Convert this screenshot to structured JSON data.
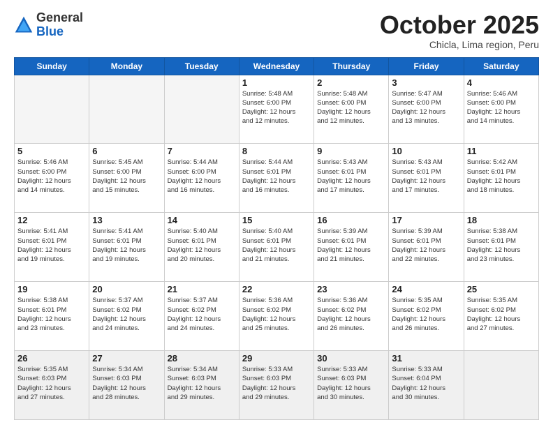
{
  "header": {
    "logo_general": "General",
    "logo_blue": "Blue",
    "month_title": "October 2025",
    "location": "Chicla, Lima region, Peru"
  },
  "weekdays": [
    "Sunday",
    "Monday",
    "Tuesday",
    "Wednesday",
    "Thursday",
    "Friday",
    "Saturday"
  ],
  "weeks": [
    [
      {
        "day": "",
        "detail": ""
      },
      {
        "day": "",
        "detail": ""
      },
      {
        "day": "",
        "detail": ""
      },
      {
        "day": "1",
        "detail": "Sunrise: 5:48 AM\nSunset: 6:00 PM\nDaylight: 12 hours\nand 12 minutes."
      },
      {
        "day": "2",
        "detail": "Sunrise: 5:48 AM\nSunset: 6:00 PM\nDaylight: 12 hours\nand 12 minutes."
      },
      {
        "day": "3",
        "detail": "Sunrise: 5:47 AM\nSunset: 6:00 PM\nDaylight: 12 hours\nand 13 minutes."
      },
      {
        "day": "4",
        "detail": "Sunrise: 5:46 AM\nSunset: 6:00 PM\nDaylight: 12 hours\nand 14 minutes."
      }
    ],
    [
      {
        "day": "5",
        "detail": "Sunrise: 5:46 AM\nSunset: 6:00 PM\nDaylight: 12 hours\nand 14 minutes."
      },
      {
        "day": "6",
        "detail": "Sunrise: 5:45 AM\nSunset: 6:00 PM\nDaylight: 12 hours\nand 15 minutes."
      },
      {
        "day": "7",
        "detail": "Sunrise: 5:44 AM\nSunset: 6:00 PM\nDaylight: 12 hours\nand 16 minutes."
      },
      {
        "day": "8",
        "detail": "Sunrise: 5:44 AM\nSunset: 6:01 PM\nDaylight: 12 hours\nand 16 minutes."
      },
      {
        "day": "9",
        "detail": "Sunrise: 5:43 AM\nSunset: 6:01 PM\nDaylight: 12 hours\nand 17 minutes."
      },
      {
        "day": "10",
        "detail": "Sunrise: 5:43 AM\nSunset: 6:01 PM\nDaylight: 12 hours\nand 17 minutes."
      },
      {
        "day": "11",
        "detail": "Sunrise: 5:42 AM\nSunset: 6:01 PM\nDaylight: 12 hours\nand 18 minutes."
      }
    ],
    [
      {
        "day": "12",
        "detail": "Sunrise: 5:41 AM\nSunset: 6:01 PM\nDaylight: 12 hours\nand 19 minutes."
      },
      {
        "day": "13",
        "detail": "Sunrise: 5:41 AM\nSunset: 6:01 PM\nDaylight: 12 hours\nand 19 minutes."
      },
      {
        "day": "14",
        "detail": "Sunrise: 5:40 AM\nSunset: 6:01 PM\nDaylight: 12 hours\nand 20 minutes."
      },
      {
        "day": "15",
        "detail": "Sunrise: 5:40 AM\nSunset: 6:01 PM\nDaylight: 12 hours\nand 21 minutes."
      },
      {
        "day": "16",
        "detail": "Sunrise: 5:39 AM\nSunset: 6:01 PM\nDaylight: 12 hours\nand 21 minutes."
      },
      {
        "day": "17",
        "detail": "Sunrise: 5:39 AM\nSunset: 6:01 PM\nDaylight: 12 hours\nand 22 minutes."
      },
      {
        "day": "18",
        "detail": "Sunrise: 5:38 AM\nSunset: 6:01 PM\nDaylight: 12 hours\nand 23 minutes."
      }
    ],
    [
      {
        "day": "19",
        "detail": "Sunrise: 5:38 AM\nSunset: 6:01 PM\nDaylight: 12 hours\nand 23 minutes."
      },
      {
        "day": "20",
        "detail": "Sunrise: 5:37 AM\nSunset: 6:02 PM\nDaylight: 12 hours\nand 24 minutes."
      },
      {
        "day": "21",
        "detail": "Sunrise: 5:37 AM\nSunset: 6:02 PM\nDaylight: 12 hours\nand 24 minutes."
      },
      {
        "day": "22",
        "detail": "Sunrise: 5:36 AM\nSunset: 6:02 PM\nDaylight: 12 hours\nand 25 minutes."
      },
      {
        "day": "23",
        "detail": "Sunrise: 5:36 AM\nSunset: 6:02 PM\nDaylight: 12 hours\nand 26 minutes."
      },
      {
        "day": "24",
        "detail": "Sunrise: 5:35 AM\nSunset: 6:02 PM\nDaylight: 12 hours\nand 26 minutes."
      },
      {
        "day": "25",
        "detail": "Sunrise: 5:35 AM\nSunset: 6:02 PM\nDaylight: 12 hours\nand 27 minutes."
      }
    ],
    [
      {
        "day": "26",
        "detail": "Sunrise: 5:35 AM\nSunset: 6:03 PM\nDaylight: 12 hours\nand 27 minutes."
      },
      {
        "day": "27",
        "detail": "Sunrise: 5:34 AM\nSunset: 6:03 PM\nDaylight: 12 hours\nand 28 minutes."
      },
      {
        "day": "28",
        "detail": "Sunrise: 5:34 AM\nSunset: 6:03 PM\nDaylight: 12 hours\nand 29 minutes."
      },
      {
        "day": "29",
        "detail": "Sunrise: 5:33 AM\nSunset: 6:03 PM\nDaylight: 12 hours\nand 29 minutes."
      },
      {
        "day": "30",
        "detail": "Sunrise: 5:33 AM\nSunset: 6:03 PM\nDaylight: 12 hours\nand 30 minutes."
      },
      {
        "day": "31",
        "detail": "Sunrise: 5:33 AM\nSunset: 6:04 PM\nDaylight: 12 hours\nand 30 minutes."
      },
      {
        "day": "",
        "detail": ""
      }
    ]
  ]
}
